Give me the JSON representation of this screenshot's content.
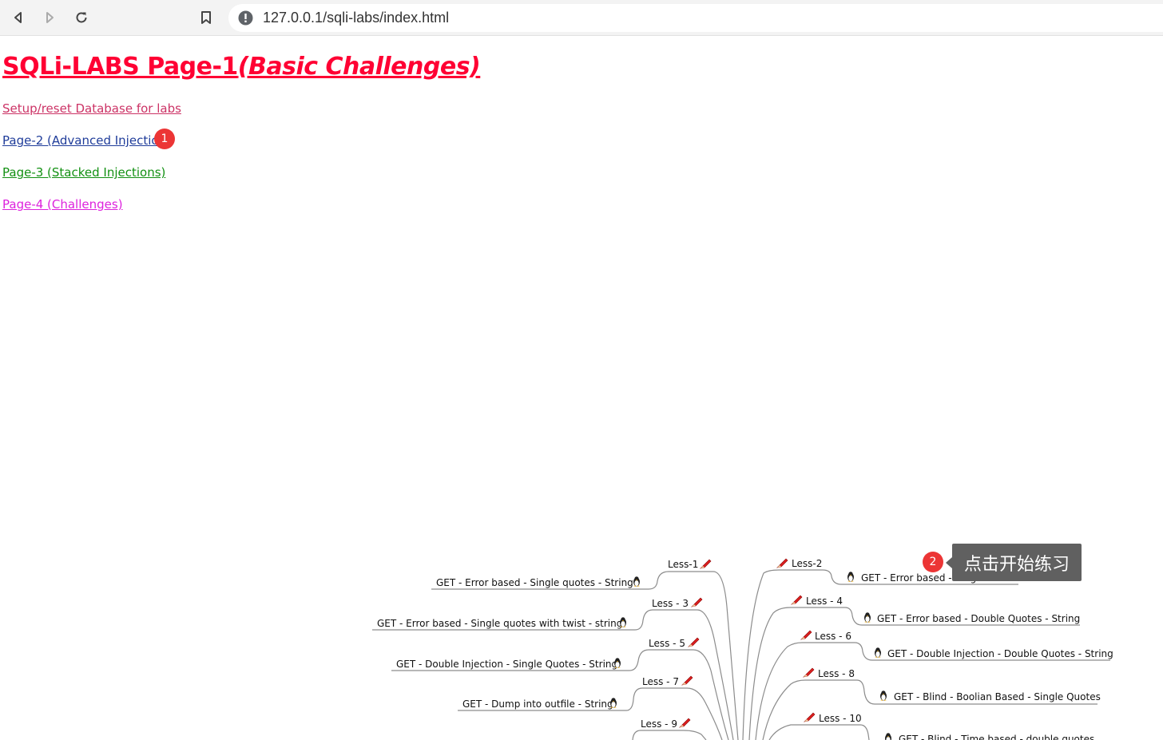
{
  "browser": {
    "url": "127.0.0.1/sqli-labs/index.html"
  },
  "page": {
    "title_main": "SQLi-LABS Page-1",
    "title_sub": "(Basic Challenges)",
    "links": {
      "setup": "Setup/reset Database for labs",
      "page2": "Page-2 (Advanced Injection",
      "page3": "Page-3 (Stacked Injections)",
      "page4": "Page-4 (Challenges)"
    }
  },
  "annotations": {
    "badge1": "1",
    "badge2": "2",
    "tooltip": "点击开始练习"
  },
  "mindmap": {
    "left": [
      {
        "lesson": "Less-1",
        "desc": "GET - Error based - Single quotes - String"
      },
      {
        "lesson": "Less - 3",
        "desc": "GET - Error based - Single quotes with twist - string"
      },
      {
        "lesson": "Less - 5",
        "desc": "GET - Double Injection - Single Quotes - String"
      },
      {
        "lesson": "Less - 7",
        "desc": "GET - Dump into outfile - String"
      },
      {
        "lesson": "Less - 9",
        "desc": ""
      }
    ],
    "right": [
      {
        "lesson": "Less-2",
        "desc": "GET - Error based - Intiger based"
      },
      {
        "lesson": "Less - 4",
        "desc": "GET - Error based - Double Quotes - String"
      },
      {
        "lesson": "Less - 6",
        "desc": "GET - Double Injection - Double Quotes - String"
      },
      {
        "lesson": "Less - 8",
        "desc": "GET - Blind - Boolian Based - Single Quotes"
      },
      {
        "lesson": "Less - 10",
        "desc": "GET - Blind - Time based - double quotes"
      }
    ]
  }
}
